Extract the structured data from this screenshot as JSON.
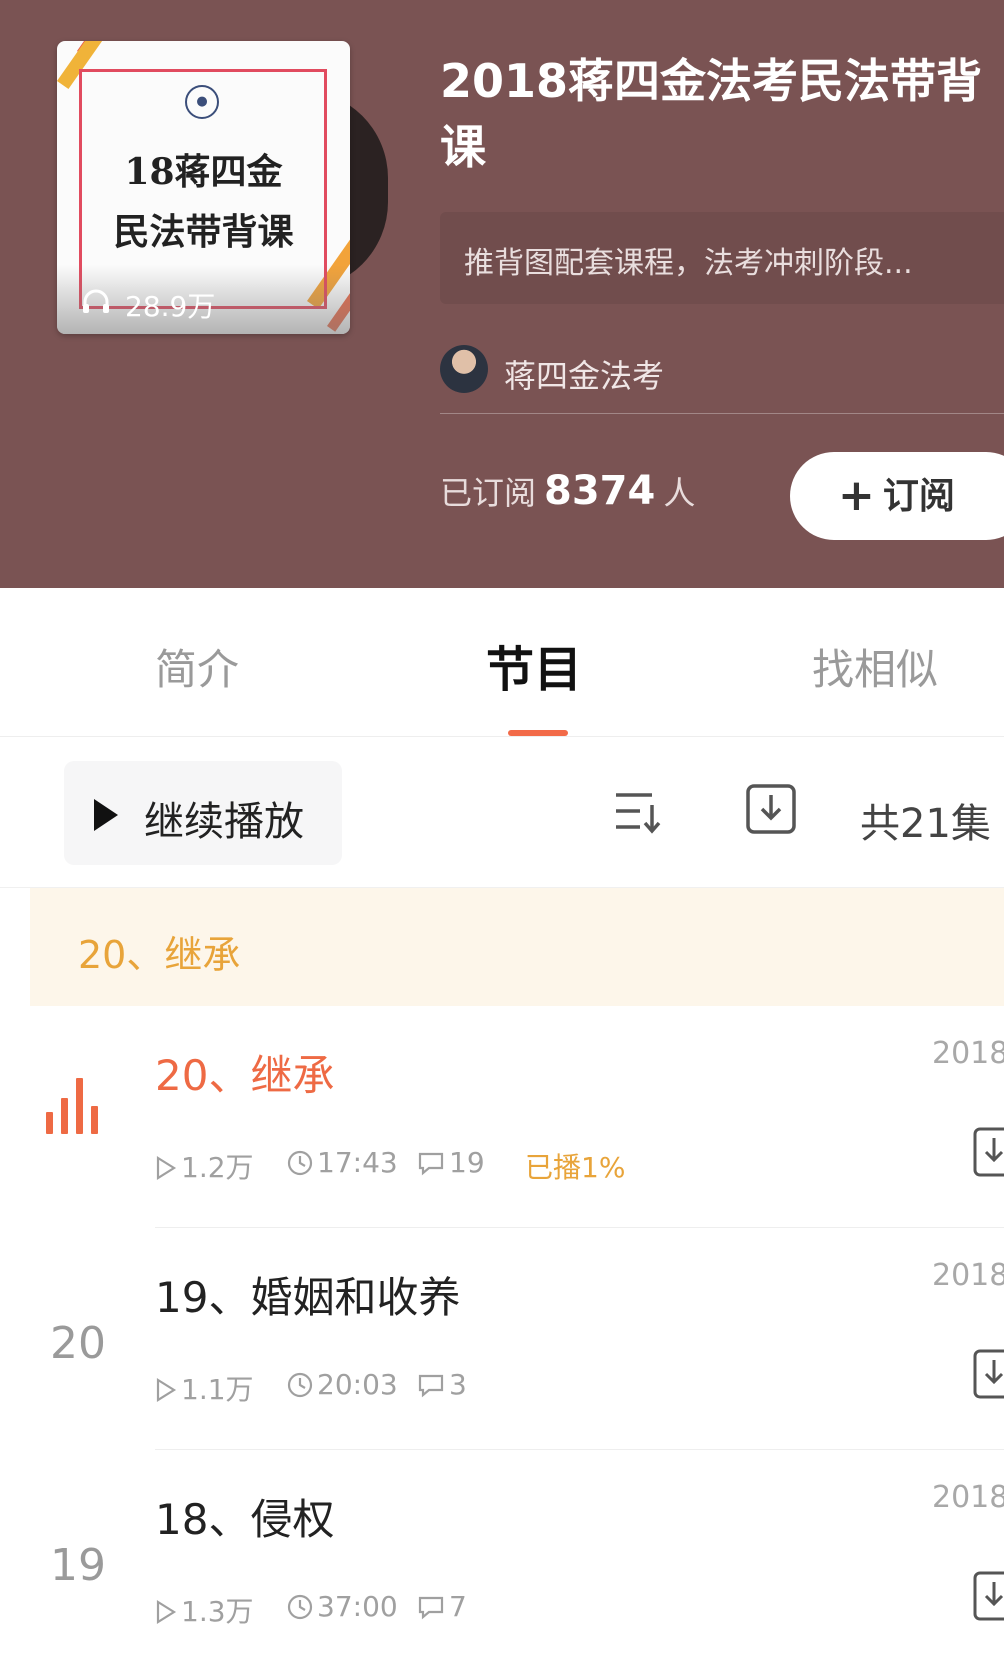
{
  "album": {
    "cover_line1": "18蒋四金",
    "cover_line2": "民法带背课",
    "cover_plays": "28.9万",
    "title": "2018蒋四金法考民法带背课",
    "description": "推背图配套课程，法考冲刺阶段...",
    "author_name": "蒋四金法考",
    "subscribed_prefix": "已订阅",
    "subscribed_count": "8374",
    "subscribed_suffix": "人",
    "subscribe_label": "订阅"
  },
  "tabs": [
    {
      "label": "简介"
    },
    {
      "label": "节目"
    },
    {
      "label": "找相似"
    }
  ],
  "toolbar": {
    "continue_label": "继续播放",
    "total_label": "共21集"
  },
  "banner": {
    "text": "20、继承"
  },
  "episodes": [
    {
      "index": "",
      "title": "20、继承",
      "date": "2018",
      "plays": "1.2万",
      "duration": "17:43",
      "comments": "19",
      "progress": "已播1%",
      "playing": true
    },
    {
      "index": "20",
      "title": "19、婚姻和收养",
      "date": "2018",
      "plays": "1.1万",
      "duration": "20:03",
      "comments": "3"
    },
    {
      "index": "19",
      "title": "18、侵权",
      "date": "2018",
      "plays": "1.3万",
      "duration": "37:00",
      "comments": "7"
    }
  ],
  "colors": {
    "header_bg": "#7a5353",
    "accent": "#ee6a44",
    "progress": "#e8a43a"
  },
  "icons": {
    "headphones": "headphones-icon",
    "play": "play-icon",
    "sort": "sort-icon",
    "download": "download-icon",
    "clock": "clock-icon",
    "comment": "comment-icon",
    "playing_bars": "playing-bars-icon"
  }
}
